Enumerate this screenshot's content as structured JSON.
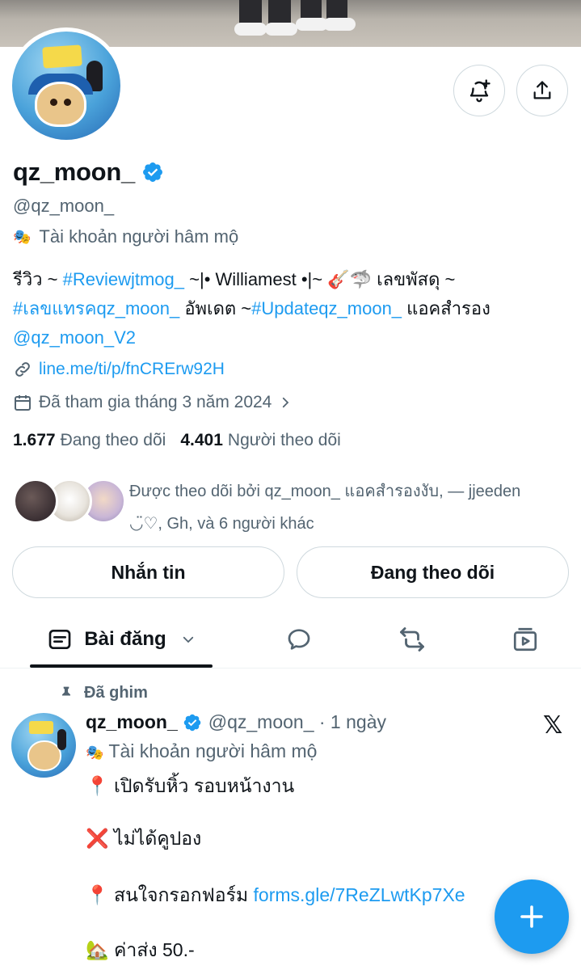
{
  "profile": {
    "display_name": "qz_moon_",
    "handle": "@qz_moon_",
    "fan_label": "Tài khoản người hâm mộ",
    "bio": {
      "p1": "รีวิว ~ ",
      "tag1": "#Reviewjtmog_",
      "p2": " ~|• Williamest •|~ 🎸🦈 เลขพัสดุ ~",
      "tag2": "#เลขแทรคqz_moon_",
      "p3": " อัพเดต ~",
      "tag3": "#Updateqz_moon_",
      "p4": " แอคสำรอง",
      "mention": "@qz_moon_V2"
    },
    "link": "line.me/ti/p/fnCRErw92H",
    "joined": "Đã tham gia tháng 3 năm 2024",
    "following_count": "1.677",
    "following_label": "Đang theo dõi",
    "followers_count": "4.401",
    "followers_label": "Người theo dõi",
    "followed_by_line1": "Được theo dõi bởi qz_moon_ แอคสำรองงับ, — jjeeden",
    "followed_by_line2": "◡̈♡, Gh, và 6 người khác"
  },
  "actions": {
    "message_label": "Nhắn tin",
    "following_label": "Đang theo dõi"
  },
  "tabs": {
    "posts_label": "Bài đăng"
  },
  "post": {
    "pinned_label": "Đã ghim",
    "author": "qz_moon_",
    "handle_time": "@qz_moon_ · 1 ngày",
    "fan_label": "Tài khoản người hâm mộ",
    "line1": "📍 เปิดรับหิ้ว รอบหน้างาน",
    "line2": "❌ ไม่ได้คูปอง",
    "line3_text": "📍 สนใจกรอกฟอร์ม ",
    "line3_link": "forms.gle/7ReZLwtKp7Xe",
    "line4": "🏡 ค่าส่ง 50.-"
  },
  "colors": {
    "accent": "#1d9bf0",
    "text": "#0f1419",
    "muted": "#536471",
    "border": "#cfd9de"
  },
  "icons": [
    "bell-plus-icon",
    "share-icon",
    "verified-badge-icon",
    "theater-mask-icon",
    "link-icon",
    "calendar-icon",
    "chevron-right-icon",
    "posts-tab-icon",
    "chevron-down-icon",
    "replies-icon",
    "retweet-icon",
    "media-icon",
    "pin-icon",
    "x-logo-icon",
    "plus-icon"
  ]
}
